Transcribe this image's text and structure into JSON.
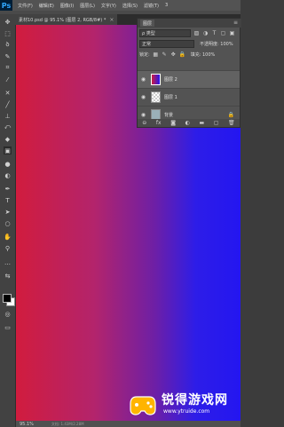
{
  "app": {
    "logo": "Ps"
  },
  "menu": [
    "文件(F)",
    "编辑(E)",
    "图像(I)",
    "图层(L)",
    "文字(Y)",
    "选择(S)",
    "滤镜(T)",
    "3"
  ],
  "document_tab": {
    "title": "素材10.psd @ 95.1% (图层 2, RGB/8#) *",
    "close": "×"
  },
  "tools": [
    "move-icon",
    "marquee-icon",
    "lasso-icon",
    "quick-select-icon",
    "crop-icon",
    "eyedropper-icon",
    "healing-icon",
    "brush-icon",
    "stamp-icon",
    "history-brush-icon",
    "eraser-icon",
    "gradient-icon",
    "blur-icon",
    "dodge-icon",
    "pen-icon",
    "type-icon",
    "path-select-icon",
    "shape-icon",
    "hand-icon",
    "zoom-icon"
  ],
  "layers_panel": {
    "tab_label": "图层",
    "filter_label": "ρ 类型",
    "blend_mode": "正常",
    "opacity_label": "不透明度: 100%",
    "lock_label": "锁定:",
    "fill_label": "填充: 100%",
    "layers": [
      {
        "name": "图层 2",
        "selected": true
      },
      {
        "name": "图层 1",
        "selected": false
      },
      {
        "name": "背景",
        "selected": false,
        "locked": true
      }
    ]
  },
  "status": {
    "zoom": "95.1%",
    "doc": "文档: 1.43M/2.28M"
  },
  "canvas": {
    "gradient_colors": [
      "#d11c3e",
      "#6d1fa6",
      "#2416f0"
    ]
  },
  "watermark": {
    "title": "锐得游戏网",
    "url": "www.ytruide.com"
  }
}
